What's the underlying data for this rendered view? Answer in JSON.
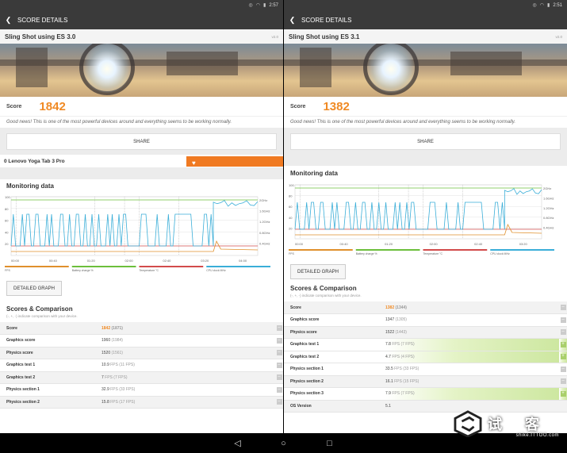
{
  "left": {
    "status_time": "2:57",
    "title": "SCORE DETAILS",
    "test_name": "Sling Shot using ES 3.0",
    "version": "v2.0",
    "score_label": "Score",
    "score": "1842",
    "good_news": "Good news! This is one of the most powerful devices around and everything seems to be working normally.",
    "share": "SHARE",
    "device": "0 Lenovo Yoga Tab 3 Pro",
    "monitoring_title": "Monitoring data",
    "detailed_graph": "DETAILED GRAPH",
    "comparison_title": "Scores & Comparison",
    "comparison_sub": "(-, +, -) indicate comparison with your device.",
    "graph_y_left": [
      "100",
      "80",
      "60",
      "40",
      "20"
    ],
    "graph_y_right": [
      "2GHz",
      "1.6GHz",
      "1.2GHz",
      "0.8GHz",
      "0.4GHz"
    ],
    "graph_x": [
      "00:00",
      "00:40",
      "01:20",
      "02:00",
      "02:40",
      "03:20",
      "04:00"
    ],
    "legend": [
      "FPS",
      "Battery charge %",
      "Temperature °C",
      "CPU clock MHz"
    ],
    "rows": [
      {
        "name": "Score",
        "value": "1842",
        "best": "(1871)",
        "exp": "–"
      },
      {
        "name": "Graphics score",
        "value": "1960",
        "best": "(1984)",
        "exp": "–"
      },
      {
        "name": "Physics score",
        "value": "1520",
        "best": "(1561)",
        "exp": "–"
      },
      {
        "name": "Graphics test 1",
        "value": "10.9",
        "best": "FPS (11 FPS)",
        "exp": "–"
      },
      {
        "name": "Graphics test 2",
        "value": "7",
        "best": "FPS (7 FPS)",
        "exp": "–"
      },
      {
        "name": "Physics section 1",
        "value": "32.9",
        "best": "FPS (33 FPS)",
        "exp": "–"
      },
      {
        "name": "Physics section 2",
        "value": "15.8",
        "best": "FPS (17 FPS)",
        "exp": "–"
      }
    ]
  },
  "right": {
    "status_time": "2:51",
    "title": "SCORE DETAILS",
    "test_name": "Sling Shot using ES 3.1",
    "version": "v2.0",
    "score_label": "Score",
    "score": "1382",
    "good_news": "Good news! This is one of the most powerful devices around and everything seems to be working normally.",
    "share": "SHARE",
    "monitoring_title": "Monitoring data",
    "detailed_graph": "DETAILED GRAPH",
    "comparison_title": "Scores & Comparison",
    "comparison_sub": "(-, +, -) indicate comparison with your device.",
    "graph_y_left": [
      "100",
      "80",
      "60",
      "40",
      "20"
    ],
    "graph_y_right": [
      "2GHz",
      "1.6GHz",
      "1.2GHz",
      "0.8GHz",
      "0.4GHz"
    ],
    "graph_x": [
      "00:00",
      "00:40",
      "01:20",
      "02:00",
      "02:40",
      "03:20"
    ],
    "legend": [
      "FPS",
      "Battery charge %",
      "Temperature °C",
      "CPU clock MHz"
    ],
    "rows": [
      {
        "name": "Score",
        "value": "1382",
        "best": "(1344)",
        "exp": "–"
      },
      {
        "name": "Graphics score",
        "value": "1347",
        "best": "(1305)",
        "exp": "–"
      },
      {
        "name": "Physics score",
        "value": "1522",
        "best": "(1443)",
        "exp": "–"
      },
      {
        "name": "Graphics test 1",
        "value": "7.8",
        "best": "FPS (7 FPS)",
        "exp": "+"
      },
      {
        "name": "Graphics test 2",
        "value": "4.7",
        "best": "FPS (4 FPS)",
        "exp": "+"
      },
      {
        "name": "Physics section 1",
        "value": "33.5",
        "best": "FPS (33 FPS)",
        "exp": "–"
      },
      {
        "name": "Physics section 2",
        "value": "16.1",
        "best": "FPS (15 FPS)",
        "exp": "–"
      },
      {
        "name": "Physics section 3",
        "value": "7.9",
        "best": "FPS (7 FPS)",
        "exp": "+"
      },
      {
        "name": "OS Version",
        "value": "5.1",
        "best": "",
        "exp": ""
      }
    ]
  },
  "watermark": {
    "text": "试 客",
    "sub": "shike.ITTOO.com"
  },
  "colors": {
    "accent": "#f08a24",
    "fps": "#3aaed8",
    "battery": "#6cbf3c",
    "temperature": "#d24b4b",
    "cpu": "#e0902c"
  }
}
